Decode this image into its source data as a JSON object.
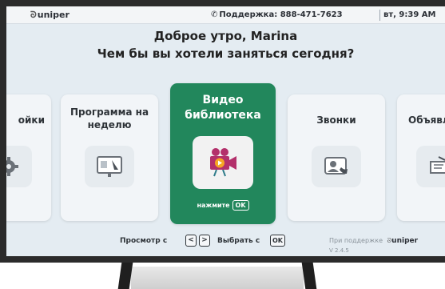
{
  "header": {
    "logo": "uniper",
    "support_label": "Поддержка: 888-471-7623",
    "time": "вт, 9:39 AM"
  },
  "greeting": {
    "line1": "Доброе утро, Marina",
    "line2": "Чем бы вы хотели заняться сегодня?"
  },
  "cards": [
    {
      "title": "ойки",
      "icon": "gear-icon"
    },
    {
      "title": "Программа на неделю",
      "icon": "presentation-icon"
    },
    {
      "title": "Видео библиотека",
      "icon": "video-camera-icon",
      "press_label": "нажмите",
      "press_key": "OK"
    },
    {
      "title": "Звонки",
      "icon": "video-call-icon"
    },
    {
      "title": "Объявл",
      "icon": "announcement-icon"
    }
  ],
  "footer": {
    "browse_label": "Просмотр с",
    "left_key": "<",
    "right_key": ">",
    "select_label": "Выбрать с",
    "ok_key": "OK",
    "powered_label": "При поддержке",
    "powered_brand": "uniper",
    "version": "V 2.4.5"
  },
  "colors": {
    "featured": "#22875c",
    "background": "#e4ecf2",
    "card": "#f2f5f8"
  }
}
